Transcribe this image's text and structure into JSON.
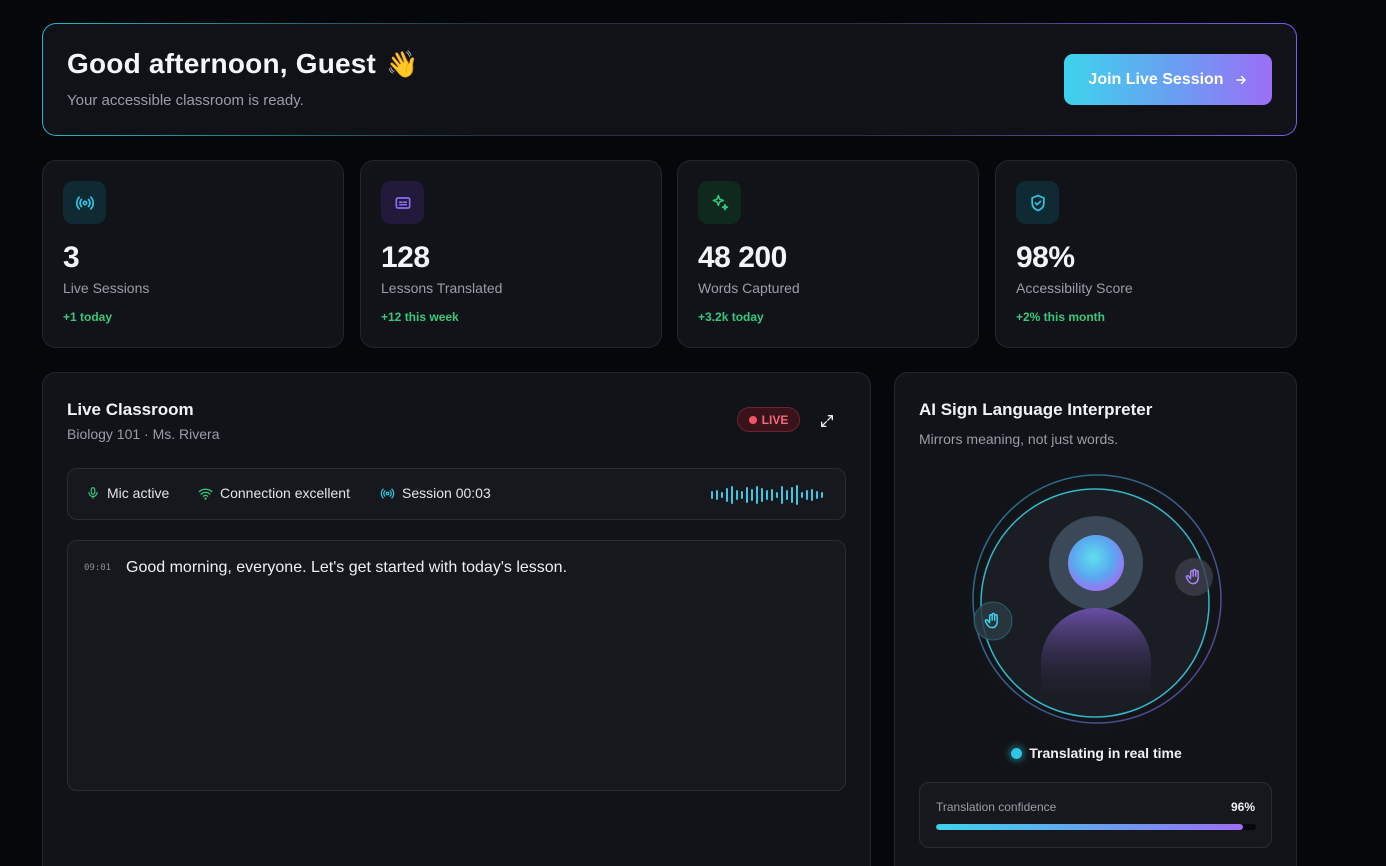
{
  "hero": {
    "greeting": "Good afternoon, Guest",
    "wave_emoji": "👋",
    "subtitle": "Your accessible classroom is ready.",
    "join_button": "Join Live Session",
    "join_icon": "arrow-right-icon"
  },
  "stats": [
    {
      "icon": "broadcast-icon",
      "value": "3",
      "label": "Live Sessions",
      "delta": "+1 today",
      "accent": "#2ec6e4"
    },
    {
      "icon": "captions-icon",
      "value": "128",
      "label": "Lessons Translated",
      "delta": "+12 this week",
      "accent": "#8b6cf0"
    },
    {
      "icon": "sparkles-icon",
      "value": "48 200",
      "label": "Words Captured",
      "delta": "+3.2k today",
      "accent": "#35c87e"
    },
    {
      "icon": "shield-check-icon",
      "value": "98%",
      "label": "Accessibility Score",
      "delta": "+2% this month",
      "accent": "#2ec6e4"
    }
  ],
  "classroom": {
    "title": "Live Classroom",
    "subtitle": "Biology 101 · Ms. Rivera",
    "live_label": "LIVE",
    "status": {
      "mic": "Mic active",
      "connection": "Connection excellent",
      "session": "Session 00:03"
    },
    "transcript": [
      {
        "time": "09:01",
        "text": "Good morning, everyone. Let's get started with today's lesson."
      }
    ]
  },
  "interpreter": {
    "title": "AI Sign Language Interpreter",
    "subtitle": "Mirrors meaning, not just words.",
    "status": "Translating in real time",
    "confidence_label": "Translation confidence",
    "confidence_value": "96%",
    "confidence_fraction": 0.96
  },
  "colors": {
    "accent_cyan": "#3ed3ec",
    "accent_violet": "#9b6ef6",
    "positive": "#35c87e",
    "live_red": "#f0566a"
  }
}
